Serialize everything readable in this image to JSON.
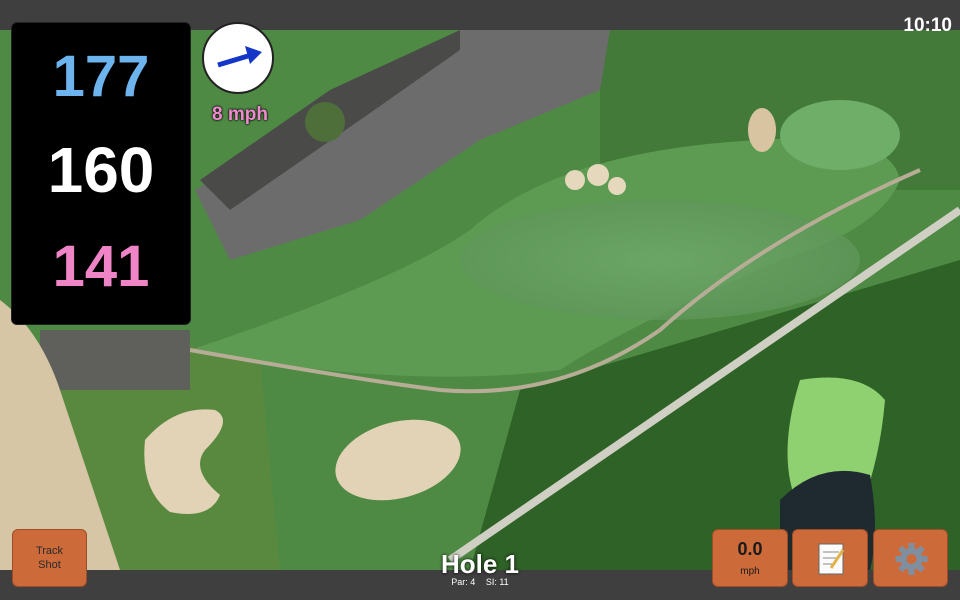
{
  "status": {
    "clock": "10:10"
  },
  "distances": {
    "back": "177",
    "center": "160",
    "front": "141"
  },
  "wind": {
    "speed": "8 mph",
    "direction_icon": "arrow-right-icon"
  },
  "buttons": {
    "track_shot": "Track\nShot",
    "speed_value": "0.0",
    "speed_unit": "mph",
    "notes_icon": "notepad-icon",
    "settings_icon": "gear-icon"
  },
  "hole": {
    "title": "Hole 1",
    "par": "Par: 4",
    "si": "SI: 11"
  },
  "colors": {
    "back": "#6db3ee",
    "center": "#ffffff",
    "front": "#ef84c7",
    "button": "#cc6a3a"
  }
}
